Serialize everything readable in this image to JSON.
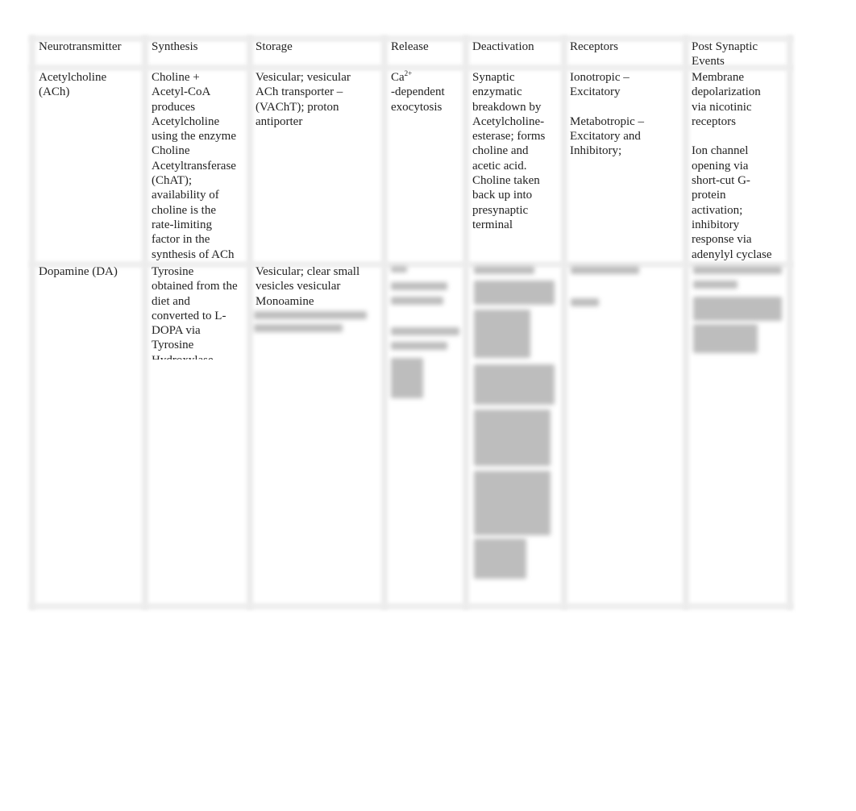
{
  "headers": [
    "Neurotransmitter",
    "Synthesis",
    "Storage",
    "Release",
    "Deactivation",
    "Receptors",
    "Post Synaptic\nEvents"
  ],
  "rows": [
    {
      "neurotransmitter": "Acetylcholine\n(ACh)",
      "synthesis": "Choline +\nAcetyl-CoA\nproduces\nAcetylcholine\nusing the enzyme\nCholine\nAcetyltransferase\n(ChAT);\navailability of\ncholine is the\nrate-limiting\nfactor in the\nsynthesis of ACh",
      "storage": "Vesicular; vesicular\nACh transporter –\n(VAChT); proton\nantiporter",
      "release_ion": "Ca",
      "release_sup": "2+",
      "release_rest": "-dependent\nexocytosis",
      "deactivation": "Synaptic\nenzymatic\nbreakdown by\nAcetylcholine-\nesterase; forms\ncholine and\nacetic acid.\nCholine taken\nback up into\npresynaptic\nterminal",
      "receptors": "Ionotropic –\nExcitatory\n\nMetabotropic –\nExcitatory and\nInhibitory;",
      "post_synaptic": "Membrane\ndepolarization\nvia nicotinic\nreceptors\n\nIon channel\nopening via\nshort-cut G-\nprotein\nactivation;\ninhibitory\nresponse via\nadenylyl cyclase"
    },
    {
      "neurotransmitter": "Dopamine (DA)",
      "synthesis": "Tyrosine\nobtained from the\ndiet and\nconverted to L-\nDOPA via\nTyrosine\nHydroxylase",
      "storage": "Vesicular; clear small\nvesicles vesicular\nMonoamine"
    }
  ]
}
